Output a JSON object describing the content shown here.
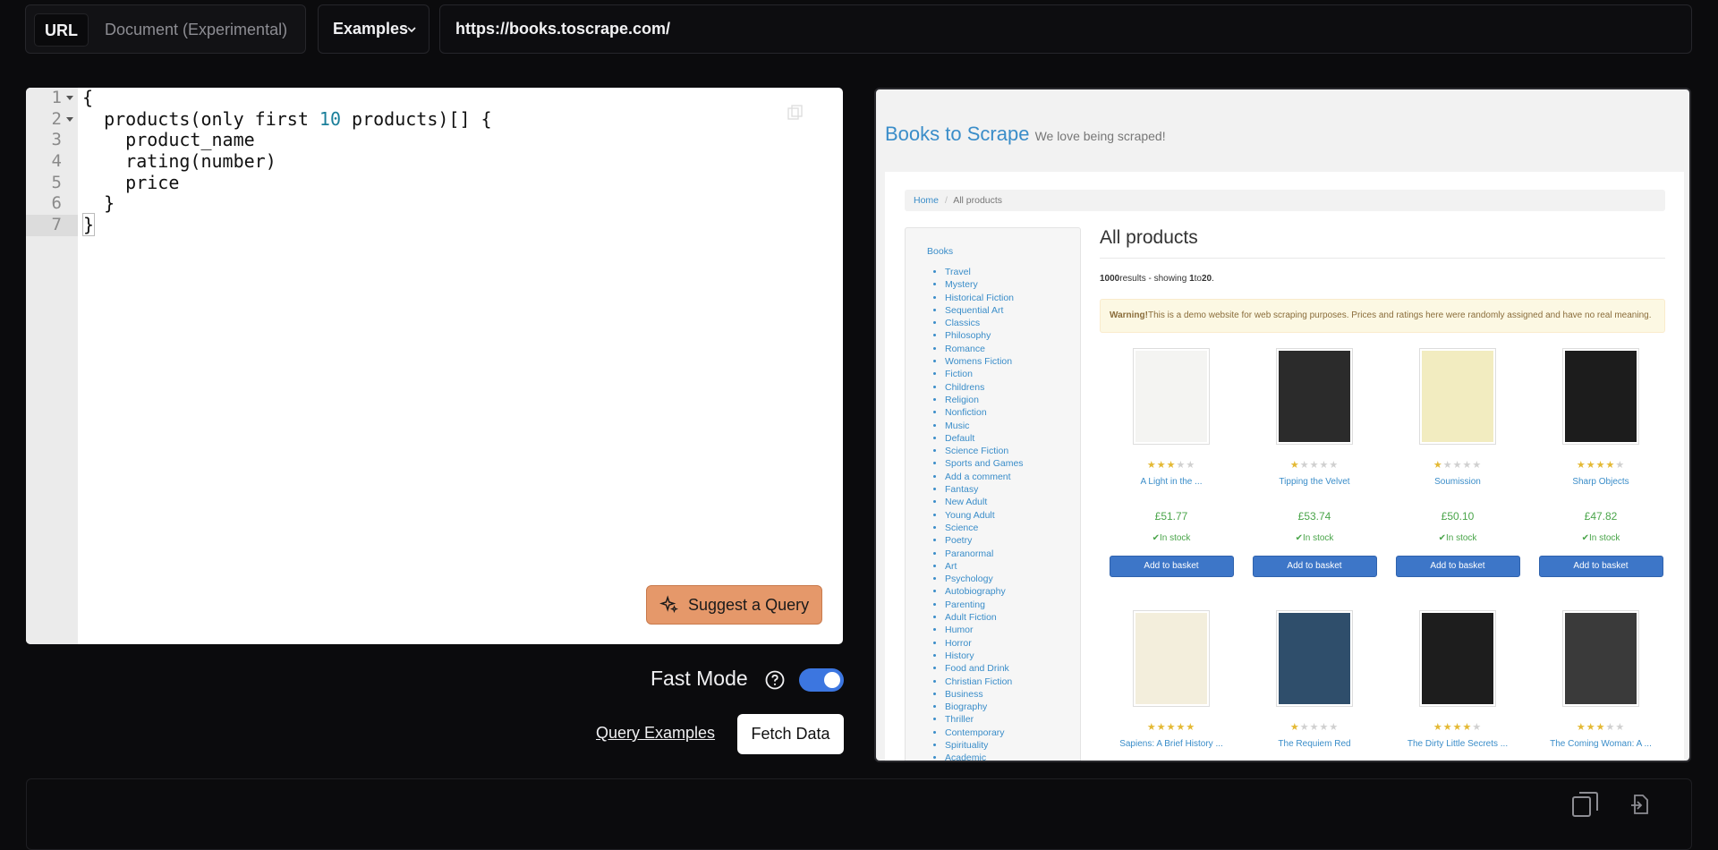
{
  "mode_tabs": {
    "url": "URL",
    "document": "Document (Experimental)"
  },
  "examples_label": "Examples",
  "url_value": "https://books.toscrape.com/",
  "editor": {
    "line_numbers": [
      "1",
      "2",
      "3",
      "4",
      "5",
      "6",
      "7"
    ],
    "lines": [
      "{",
      "  products(only first 10 products)[] {",
      "    product_name",
      "    rating(number)",
      "    price",
      "  }",
      "}"
    ]
  },
  "suggest_label": "Suggest a Query",
  "fast_mode_label": "Fast Mode",
  "fast_mode_on": true,
  "query_examples_label": "Query Examples",
  "fetch_label": "Fetch Data",
  "preview": {
    "brand": "Books to Scrape",
    "tagline": "We love being scraped!",
    "breadcrumb_home": "Home",
    "breadcrumb_sep": "/",
    "breadcrumb_current": "All products",
    "sidebar_title": "Books",
    "categories": [
      "Travel",
      "Mystery",
      "Historical Fiction",
      "Sequential Art",
      "Classics",
      "Philosophy",
      "Romance",
      "Womens Fiction",
      "Fiction",
      "Childrens",
      "Religion",
      "Nonfiction",
      "Music",
      "Default",
      "Science Fiction",
      "Sports and Games",
      "Add a comment",
      "Fantasy",
      "New Adult",
      "Young Adult",
      "Science",
      "Poetry",
      "Paranormal",
      "Art",
      "Psychology",
      "Autobiography",
      "Parenting",
      "Adult Fiction",
      "Humor",
      "Horror",
      "History",
      "Food and Drink",
      "Christian Fiction",
      "Business",
      "Biography",
      "Thriller",
      "Contemporary",
      "Spirituality",
      "Academic"
    ],
    "heading": "All products",
    "results_total": "1000",
    "results_text": "results - showing",
    "results_from": "1",
    "results_to_word": "to",
    "results_to": "20",
    "warning_bold": "Warning!",
    "warning_text": "This is a demo website for web scraping purposes. Prices and ratings here were randomly assigned and have no real meaning.",
    "in_stock": "In stock",
    "basket_label": "Add to basket",
    "products": [
      {
        "title": "A Light in the ...",
        "rating": 3,
        "price": "£51.77",
        "cover": "#f4f4f2"
      },
      {
        "title": "Tipping the Velvet",
        "rating": 1,
        "price": "£53.74",
        "cover": "#2b2b2b"
      },
      {
        "title": "Soumission",
        "rating": 1,
        "price": "£50.10",
        "cover": "#f2ecc0"
      },
      {
        "title": "Sharp Objects",
        "rating": 4,
        "price": "£47.82",
        "cover": "#1c1c1c"
      },
      {
        "title": "Sapiens: A Brief History ...",
        "rating": 5,
        "price": "",
        "cover": "#f3eedc"
      },
      {
        "title": "The Requiem Red",
        "rating": 1,
        "price": "",
        "cover": "#2f4e6b"
      },
      {
        "title": "The Dirty Little Secrets ...",
        "rating": 4,
        "price": "",
        "cover": "#1d1d1d"
      },
      {
        "title": "The Coming Woman: A ...",
        "rating": 3,
        "price": "",
        "cover": "#3a3a3a"
      }
    ]
  },
  "colors": {
    "accent_toggle": "#3c76e0",
    "suggest_bg": "#e5986a",
    "link_blue": "#3a8dc9",
    "price_green": "#4aa54a",
    "basket_blue": "#3d76c8"
  }
}
